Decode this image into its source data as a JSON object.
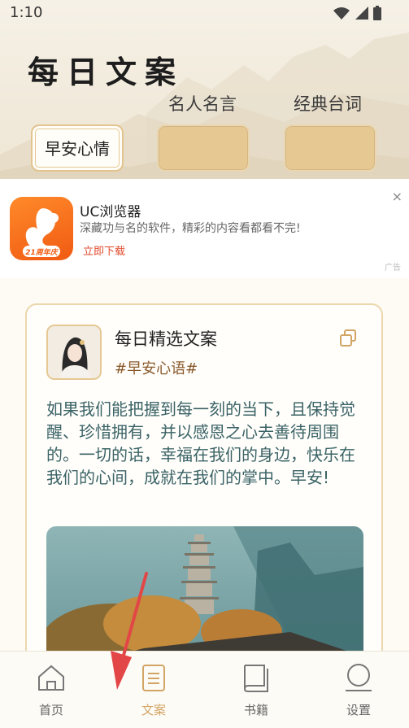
{
  "status": {
    "time": "1:10"
  },
  "header": {
    "app_title": "每日文案",
    "tabs": [
      {
        "label": "名人名言"
      },
      {
        "label": "经典台词"
      }
    ],
    "chips": [
      {
        "label": "早安心情",
        "active": true
      },
      {
        "label": "",
        "active": false
      },
      {
        "label": "",
        "active": false
      }
    ]
  },
  "ad": {
    "title": "UC浏览器",
    "description": "深藏功与名的软件，精彩的内容看都看不完!",
    "cta": "立即下载",
    "tag": "广告",
    "icon_badge": "21周年庆",
    "close": "×"
  },
  "card": {
    "title": "每日精选文案",
    "tag": "#早安心语#",
    "quote": "如果我们能把握到每一刻的当下，且保持觉醒、珍惜拥有，并以感恩之心去善待周围的。一切的话，幸福在我们的身边，快乐在我们的心间，成就在我们的掌中。早安!"
  },
  "nav": {
    "items": [
      {
        "label": "首页",
        "icon": "home-icon",
        "active": false
      },
      {
        "label": "文案",
        "icon": "document-icon",
        "active": true
      },
      {
        "label": "书籍",
        "icon": "book-icon",
        "active": false
      },
      {
        "label": "设置",
        "icon": "settings-icon",
        "active": false
      }
    ]
  },
  "colors": {
    "accent": "#d2a564",
    "chip": "#e6c893",
    "quote_text": "#3b6366",
    "tag": "#8b5a2b",
    "ad_cta": "#e14a2c"
  }
}
